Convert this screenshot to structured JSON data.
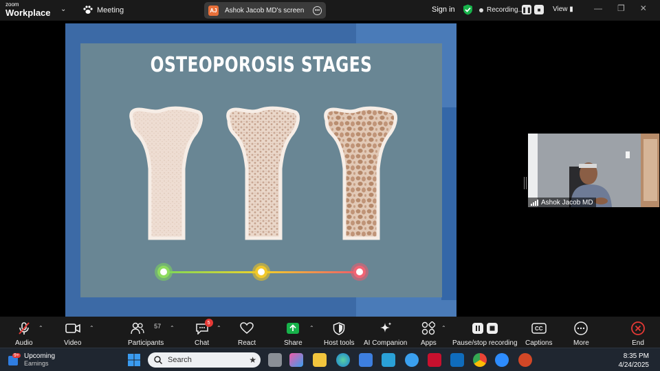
{
  "app": {
    "logo_line1": "zoom",
    "logo_line2": "Workplace"
  },
  "topbar": {
    "meeting_label": "Meeting",
    "share_initials": "AJ",
    "share_label": "Ashok Jacob MD's screen",
    "signin_label": "Sign in",
    "recording_label": "Recording...",
    "view_label": "View"
  },
  "slide": {
    "title": "OSTEOPOROSIS STAGES"
  },
  "self_view": {
    "name": "Ashok Jacob MD"
  },
  "toolbar": {
    "audio": "Audio",
    "video": "Video",
    "participants": "Participants",
    "participants_count": "57",
    "chat": "Chat",
    "chat_badge": "5",
    "react": "React",
    "share": "Share",
    "host_tools": "Host tools",
    "ai_companion": "AI Companion",
    "apps": "Apps",
    "pause_recording": "Pause/stop recording",
    "captions": "Captions",
    "captions_icon_text": "CC",
    "more": "More",
    "end": "End"
  },
  "taskbar": {
    "weather_badge": "9+",
    "weather_title": "Upcoming",
    "weather_sub": "Earnings",
    "search_placeholder": "Search",
    "time": "8:35 PM",
    "date": "4/24/2025"
  },
  "colors": {
    "stage_green": "#7ed957",
    "stage_yellow": "#f0c419",
    "stage_red": "#ef5b6b",
    "accent_green": "#17b24a",
    "end_red": "#e53935"
  }
}
